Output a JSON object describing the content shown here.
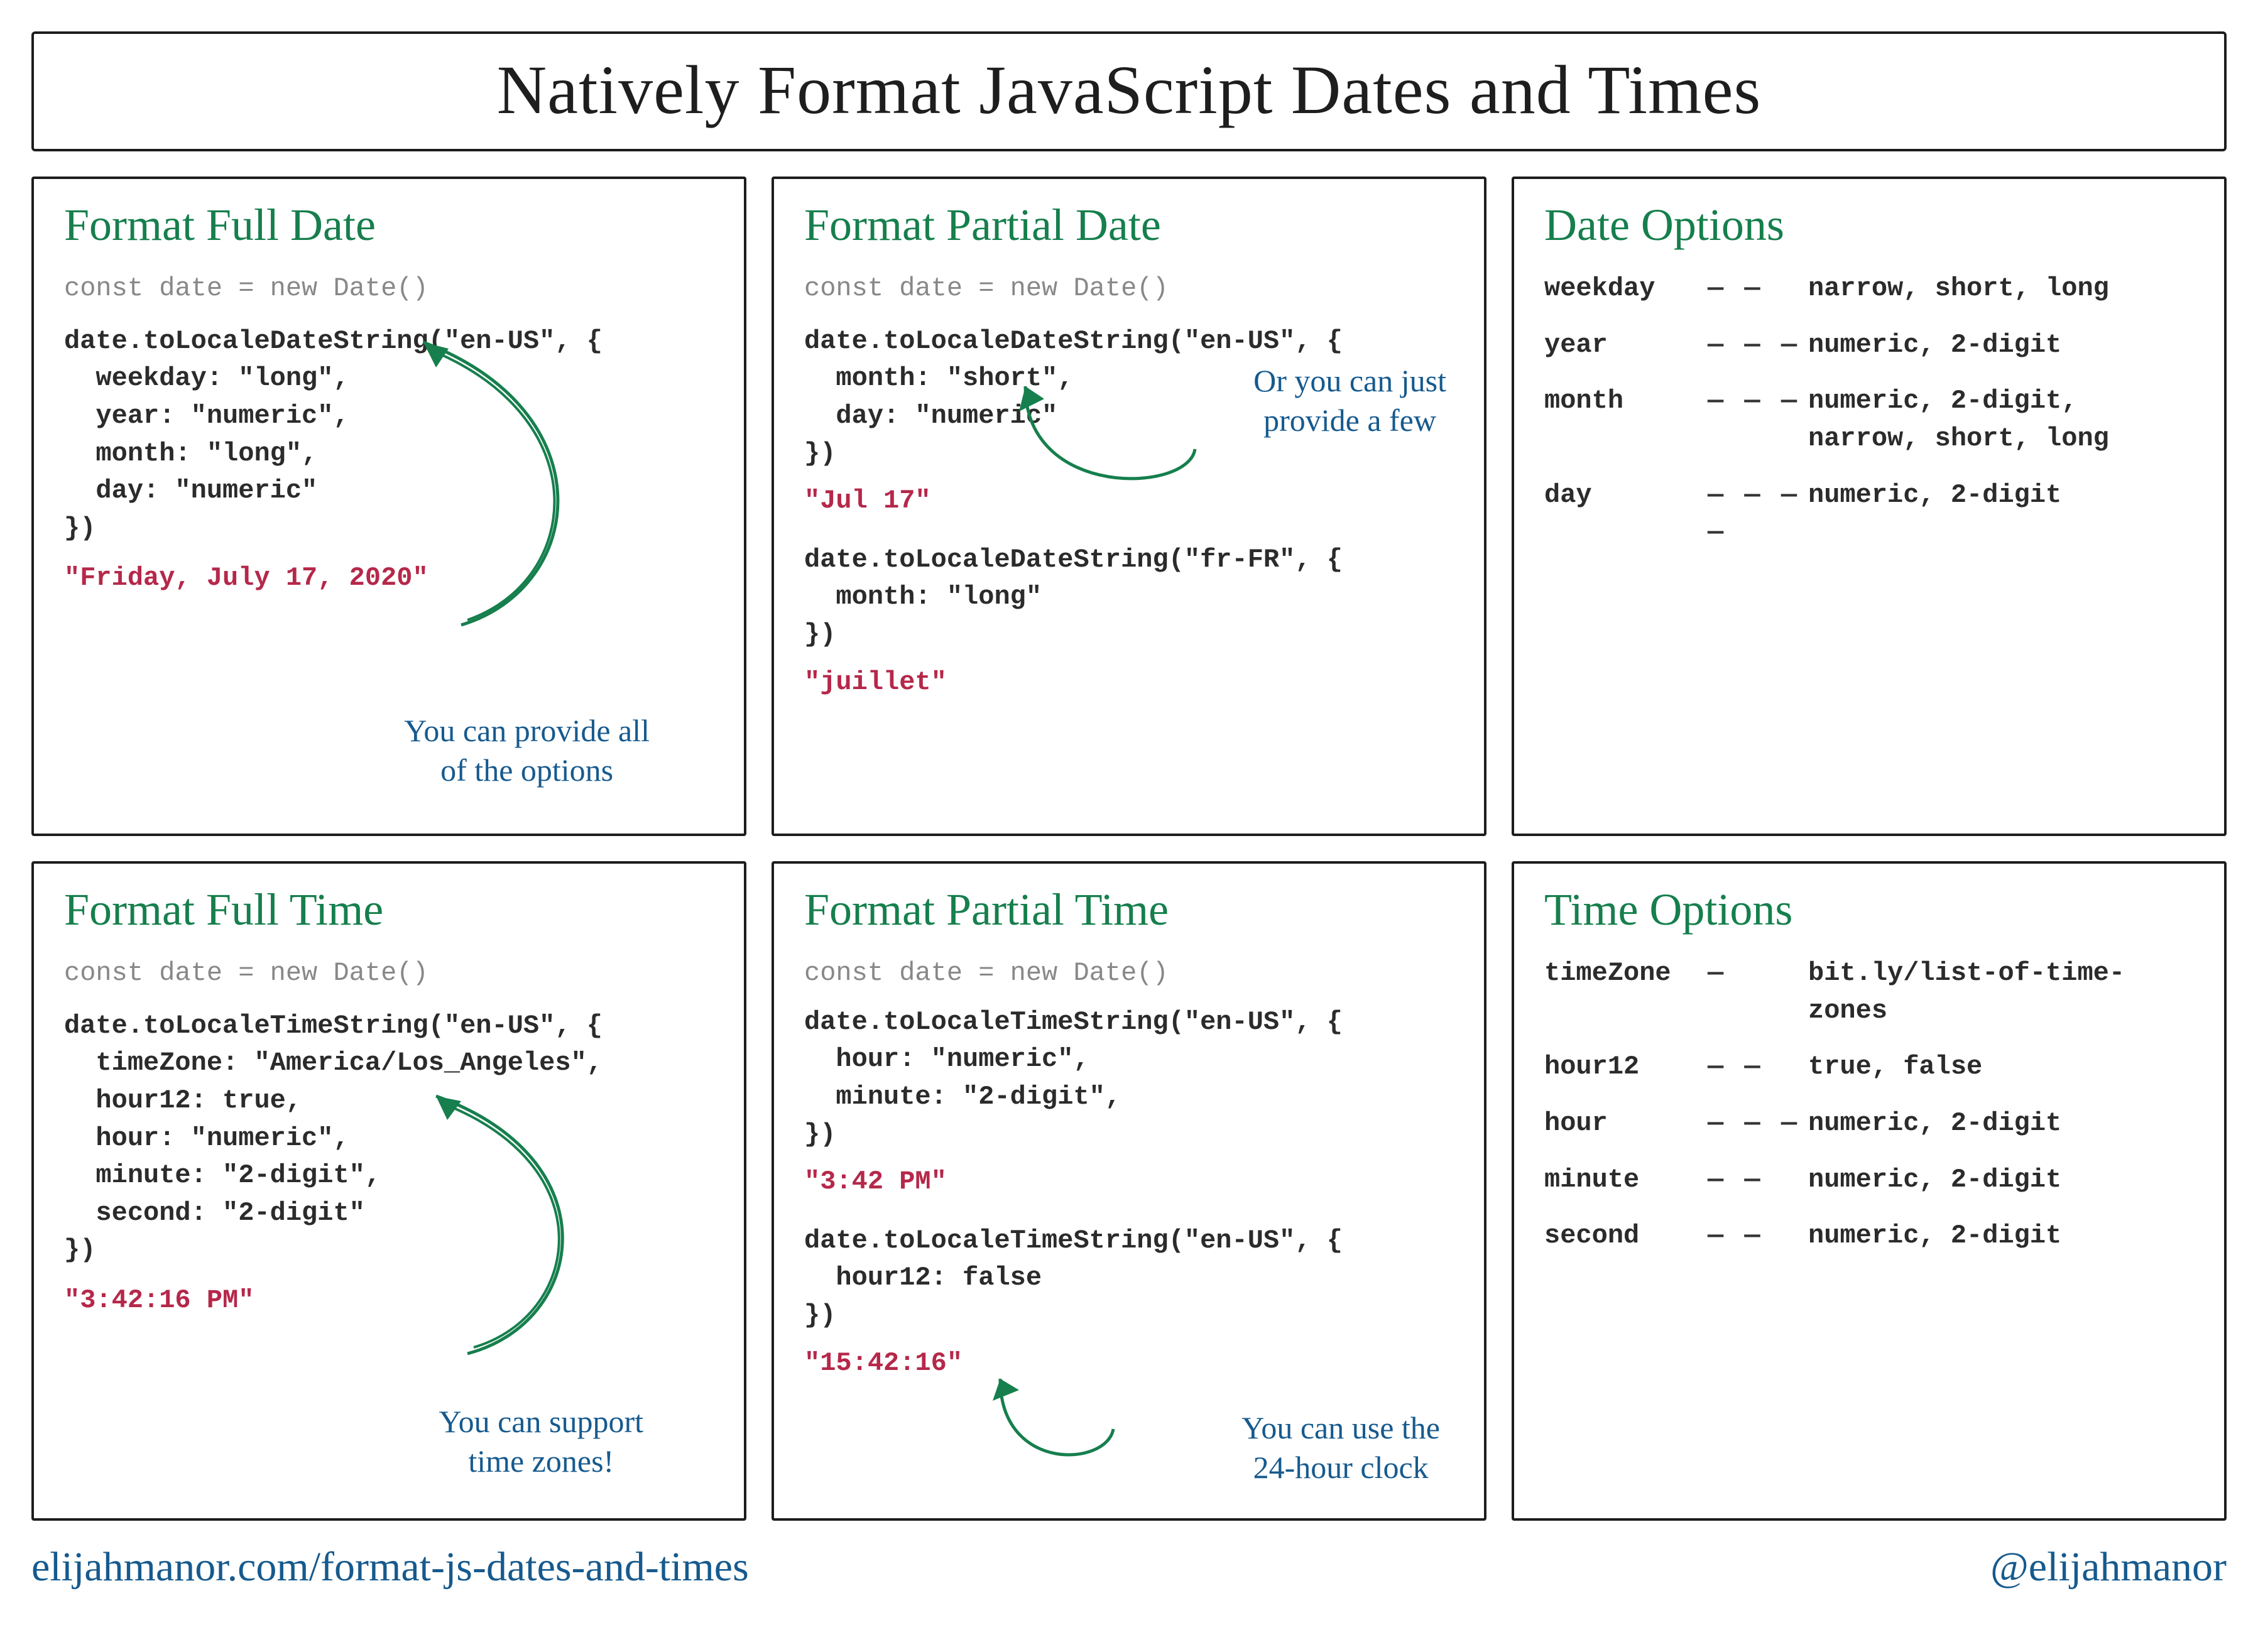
{
  "title": "Natively Format JavaScript Dates and Times",
  "cards": {
    "fullDate": {
      "heading": "Format Full Date",
      "decl": "const date = new Date()",
      "code": "date.toLocaleDateString(\"en-US\", {\n  weekday: \"long\",\n  year: \"numeric\",\n  month: \"long\",\n  day: \"numeric\"\n})",
      "output": "\"Friday, July 17, 2020\"",
      "annotation": "You can provide all\nof the options"
    },
    "partialDate": {
      "heading": "Format Partial Date",
      "decl": "const date = new Date()",
      "code1": "date.toLocaleDateString(\"en-US\", {\n  month: \"short\",\n  day: \"numeric\"\n})",
      "output1": "\"Jul 17\"",
      "code2": "date.toLocaleDateString(\"fr-FR\", {\n  month: \"long\"\n})",
      "output2": "\"juillet\"",
      "annotation": "Or you can just\nprovide a few"
    },
    "dateOptions": {
      "heading": "Date Options",
      "rows": [
        {
          "key": "weekday",
          "dash": "— —",
          "vals": "narrow, short, long"
        },
        {
          "key": "year",
          "dash": "— — —",
          "vals": "numeric, 2-digit"
        },
        {
          "key": "month",
          "dash": "— — —",
          "vals": "numeric, 2-digit,\nnarrow, short, long"
        },
        {
          "key": "day",
          "dash": "— — — —",
          "vals": "numeric, 2-digit"
        }
      ]
    },
    "fullTime": {
      "heading": "Format Full Time",
      "decl": "const date = new Date()",
      "code": "date.toLocaleTimeString(\"en-US\", {\n  timeZone: \"America/Los_Angeles\",\n  hour12: true,\n  hour: \"numeric\",\n  minute: \"2-digit\",\n  second: \"2-digit\"\n})",
      "output": "\"3:42:16 PM\"",
      "annotation": "You can support\ntime zones!"
    },
    "partialTime": {
      "heading": "Format Partial Time",
      "decl": "const date = new Date()",
      "code1": "date.toLocaleTimeString(\"en-US\", {\n  hour: \"numeric\",\n  minute: \"2-digit\",\n})",
      "output1": "\"3:42 PM\"",
      "code2": "date.toLocaleTimeString(\"en-US\", {\n  hour12: false\n})",
      "output2": "\"15:42:16\"",
      "annotation": "You can use the\n24-hour clock"
    },
    "timeOptions": {
      "heading": "Time Options",
      "rows": [
        {
          "key": "timeZone",
          "dash": "—",
          "vals": "bit.ly/list-of-time-zones"
        },
        {
          "key": "hour12",
          "dash": "— —",
          "vals": "true, false"
        },
        {
          "key": "hour",
          "dash": "— — —",
          "vals": "numeric, 2-digit"
        },
        {
          "key": "minute",
          "dash": "— —",
          "vals": "numeric, 2-digit"
        },
        {
          "key": "second",
          "dash": "— —",
          "vals": "numeric, 2-digit"
        }
      ]
    }
  },
  "footer": {
    "url": "elijahmanor.com/format-js-dates-and-times",
    "handle": "@elijahmanor"
  }
}
